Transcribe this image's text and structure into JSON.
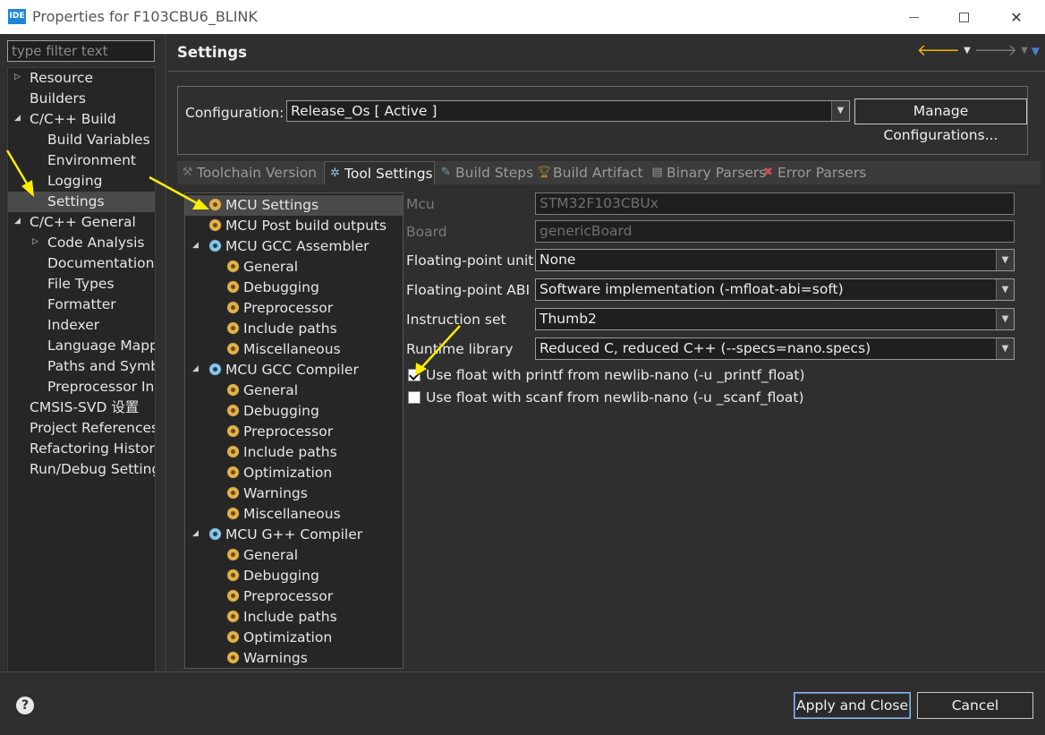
{
  "window": {
    "app_icon": "IDE",
    "title": "Properties for F103CBU6_BLINK"
  },
  "left": {
    "filter_placeholder": "type filter text",
    "items": [
      {
        "label": "Resource"
      },
      {
        "label": "Builders"
      },
      {
        "label": "C/C++ Build"
      },
      {
        "label": "Build Variables"
      },
      {
        "label": "Environment"
      },
      {
        "label": "Logging"
      },
      {
        "label": "Settings"
      },
      {
        "label": "C/C++ General"
      },
      {
        "label": "Code Analysis"
      },
      {
        "label": "Documentation"
      },
      {
        "label": "File Types"
      },
      {
        "label": "Formatter"
      },
      {
        "label": "Indexer"
      },
      {
        "label": "Language Mappi"
      },
      {
        "label": "Paths and Symbo"
      },
      {
        "label": "Preprocessor Inc"
      },
      {
        "label": "CMSIS-SVD 设置"
      },
      {
        "label": "Project References"
      },
      {
        "label": "Refactoring History"
      },
      {
        "label": "Run/Debug Setting"
      }
    ]
  },
  "main": {
    "title": "Settings",
    "config_label": "Configuration:",
    "config_value": "Release_Os  [ Active ]",
    "manage_button": "Manage Configurations...",
    "tabs": [
      {
        "label": "Toolchain  Version"
      },
      {
        "label": "Tool Settings"
      },
      {
        "label": "Build Steps"
      },
      {
        "label": "Build Artifact"
      },
      {
        "label": "Binary Parsers"
      },
      {
        "label": "Error Parsers"
      }
    ],
    "tool_tree": [
      {
        "label": "MCU Settings"
      },
      {
        "label": "MCU Post build outputs"
      },
      {
        "label": "MCU GCC Assembler"
      },
      {
        "label": "General"
      },
      {
        "label": "Debugging"
      },
      {
        "label": "Preprocessor"
      },
      {
        "label": "Include paths"
      },
      {
        "label": "Miscellaneous"
      },
      {
        "label": "MCU GCC Compiler"
      },
      {
        "label": "General"
      },
      {
        "label": "Debugging"
      },
      {
        "label": "Preprocessor"
      },
      {
        "label": "Include paths"
      },
      {
        "label": "Optimization"
      },
      {
        "label": "Warnings"
      },
      {
        "label": "Miscellaneous"
      },
      {
        "label": "MCU G++ Compiler"
      },
      {
        "label": "General"
      },
      {
        "label": "Debugging"
      },
      {
        "label": "Preprocessor"
      },
      {
        "label": "Include paths"
      },
      {
        "label": "Optimization"
      },
      {
        "label": "Warnings"
      }
    ],
    "form": {
      "mcu_label": "Mcu",
      "mcu_value": "STM32F103CBUx",
      "board_label": "Board",
      "board_value": "genericBoard",
      "fpu_label": "Floating-point unit",
      "fpu_value": "None",
      "fabi_label": "Floating-point ABI",
      "fabi_value": "Software implementation (-mfloat-abi=soft)",
      "iset_label": "Instruction set",
      "iset_value": "Thumb2",
      "rtlib_label": "Runtime library",
      "rtlib_value": "Reduced C, reduced C++ (--specs=nano.specs)",
      "printf_float_label": "Use float with printf from newlib-nano (-u _printf_float)",
      "printf_float_checked": true,
      "scanf_float_label": "Use float with scanf from newlib-nano (-u _scanf_float)",
      "scanf_float_checked": false
    }
  },
  "bottom": {
    "help": "?",
    "apply_close": "Apply and Close",
    "cancel": "Cancel"
  },
  "colors": {
    "annotation_arrow": "#ffee00",
    "nav_back_arrow": "#f5b301"
  }
}
